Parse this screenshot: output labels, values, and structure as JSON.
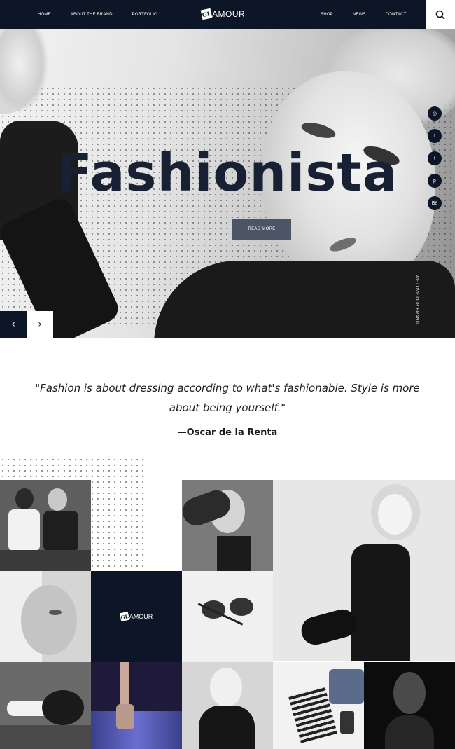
{
  "header": {
    "nav_left": [
      "HOME",
      "ABOUT THE BRAND",
      "PORTFOLIO"
    ],
    "nav_right": [
      "SHOP",
      "NEWS",
      "CONTACT"
    ],
    "logo_mark": "GL",
    "logo_rest": "AMOUR",
    "search_icon": "search-icon"
  },
  "hero": {
    "title": "Fashionista",
    "button_label": "READ MORE",
    "social_icons": [
      "instagram-icon",
      "facebook-icon",
      "twitter-icon",
      "pinterest-icon",
      "behance-icon"
    ],
    "social_glyphs": [
      "◎",
      "f",
      "t",
      "p",
      "Bē"
    ],
    "vertical_text": "WE LOVE OUR BRAND",
    "prev_arrow": "‹",
    "next_arrow": "›"
  },
  "quote": {
    "text": "\"Fashion is about dressing according to what's fashionable. Style is more about being yourself.\"",
    "author": "—Oscar de la Renta"
  },
  "gallery": {
    "logo_mark": "GL",
    "logo_rest": "AMOUR"
  },
  "colors": {
    "navy": "#0d1627",
    "title": "#172133",
    "button": "#4b5566"
  }
}
